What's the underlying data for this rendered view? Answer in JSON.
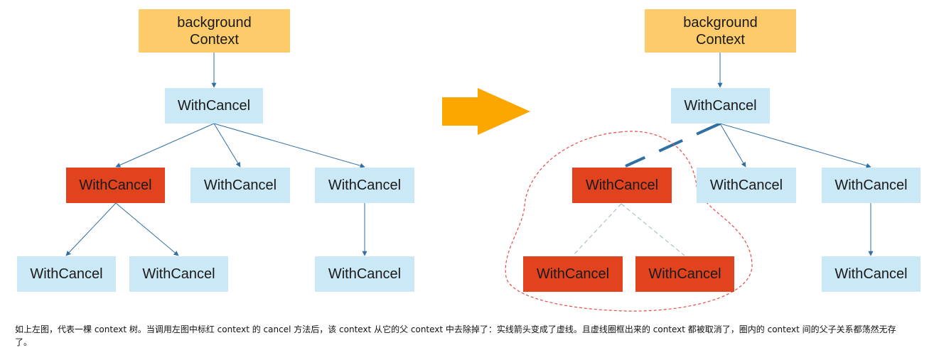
{
  "left": {
    "root": "background\nContext",
    "mid": "WithCancel",
    "child_a": "WithCancel",
    "child_b": "WithCancel",
    "child_c": "WithCancel",
    "grand_a1": "WithCancel",
    "grand_a2": "WithCancel",
    "grand_c1": "WithCancel"
  },
  "right": {
    "root": "background\nContext",
    "mid": "WithCancel",
    "child_a": "WithCancel",
    "child_b": "WithCancel",
    "child_c": "WithCancel",
    "grand_a1": "WithCancel",
    "grand_a2": "WithCancel",
    "grand_c1": "WithCancel"
  },
  "colors": {
    "root_fill": "#fdcb6a",
    "node_fill": "#cbe8f6",
    "cancelled_fill": "#e1431e",
    "solid_edge": "#2e6fa4",
    "dashed_edge": "#9ab7c0",
    "cut_edge": "#2e6fa4",
    "region_outline": "#e84a4a",
    "big_arrow": "#fca600"
  },
  "caption": "如上左图，代表一棵 context 树。当调用左图中标红 context 的 cancel 方法后，该 context 从它的父 context 中去除掉了：实线箭头变成了虚线。且虚线圈框出来的 context 都被取消了，圈内的 context 间的父子关系都荡然无存了。"
}
